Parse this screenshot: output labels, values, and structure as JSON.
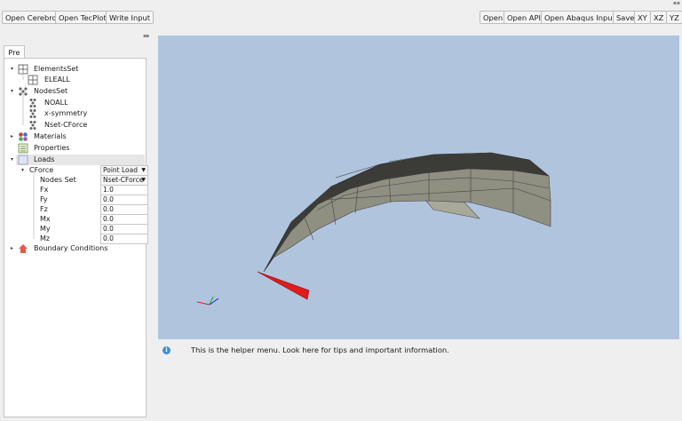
{
  "toolbar": {
    "left": [
      "Open Cerebro",
      "Open TecPlot",
      "Write Input"
    ],
    "right": [
      "Open",
      "Open API",
      "Open Abaqus Input",
      "Save",
      "XY",
      "XZ",
      "YZ"
    ]
  },
  "tab": {
    "label": "Pre"
  },
  "tree": {
    "elements_set": "ElementsSet",
    "eleall": "ELEALL",
    "nodes_set": "NodesSet",
    "noall": "NOALL",
    "x_symmetry": "x-symmetry",
    "nset_cforce": "Nset-CForce",
    "materials": "Materials",
    "properties": "Properties",
    "loads": "Loads",
    "cforce": "CForce",
    "cforce_type": "Point Load",
    "nodes_set_label": "Nodes Set",
    "nodes_set_value": "Nset-CForce",
    "fields": [
      {
        "label": "Fx",
        "value": "1.0"
      },
      {
        "label": "Fy",
        "value": "0.0"
      },
      {
        "label": "Fz",
        "value": "0.0"
      },
      {
        "label": "Mx",
        "value": "0.0"
      },
      {
        "label": "My",
        "value": "0.0"
      },
      {
        "label": "Mz",
        "value": "0.0"
      }
    ],
    "boundary_conditions": "Boundary Conditions"
  },
  "viewport": {
    "background": "#b0c4de",
    "surface_color": "#8f8f82",
    "load_arrow_color": "#e01b1b"
  },
  "helper": {
    "text": "This is the helper menu. Look here for tips and important information."
  }
}
